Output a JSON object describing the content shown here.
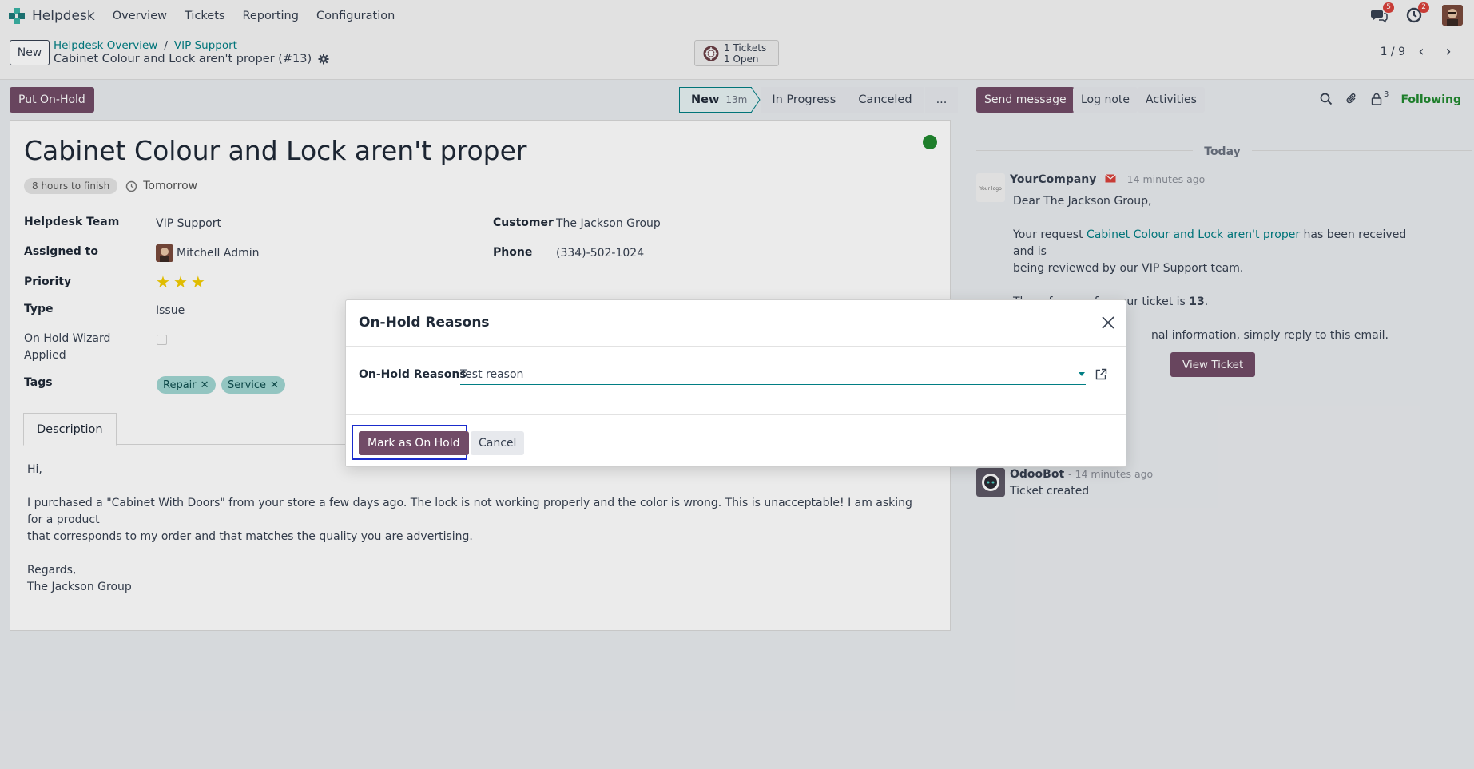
{
  "app": {
    "name": "Helpdesk",
    "menu": [
      "Overview",
      "Tickets",
      "Reporting",
      "Configuration"
    ],
    "messages_count": "5",
    "activities_count": "2"
  },
  "control_panel": {
    "new_label": "New",
    "breadcrumbs": [
      "Helpdesk Overview",
      "VIP Support"
    ],
    "breadcrumb_separator": "/",
    "record_name": "Cabinet Colour and Lock aren't proper (#13)",
    "ticket_stat_line1": "1 Tickets",
    "ticket_stat_line2": "1 Open",
    "pager": "1 / 9"
  },
  "status_bar": {
    "hold_button": "Put On-Hold",
    "stages": [
      {
        "label": "New",
        "duration": "13m",
        "active": true
      },
      {
        "label": "In Progress"
      },
      {
        "label": "Canceled"
      },
      {
        "label": "..."
      }
    ]
  },
  "ticket": {
    "title": "Cabinet Colour and Lock aren't proper",
    "deadline_badge": "8 hours to finish",
    "deadline_date": "Tomorrow",
    "fields": {
      "team_label": "Helpdesk Team",
      "team_value": "VIP Support",
      "assigned_label": "Assigned to",
      "assigned_value": "Mitchell Admin",
      "priority_label": "Priority",
      "priority_stars": 3,
      "type_label": "Type",
      "type_value": "Issue",
      "onhold_label_1": "On Hold Wizard",
      "onhold_label_2": "Applied",
      "tags_label": "Tags",
      "tags": [
        "Repair",
        "Service"
      ],
      "customer_label": "Customer",
      "customer_value": "The Jackson Group",
      "phone_label": "Phone",
      "phone_value": "(334)-502-1024"
    },
    "tab_description": "Description",
    "description": {
      "greeting": "Hi,",
      "body_1": "I purchased a \"Cabinet With Doors\" from your store a few days ago. The lock is not working properly and the color is wrong. This is unacceptable! I am asking for a product",
      "body_2": "that corresponds to my order and that matches the quality you are advertising.",
      "closing_1": "Regards,",
      "closing_2": "The Jackson Group"
    }
  },
  "chatter": {
    "send_message": "Send message",
    "log_note": "Log note",
    "activities": "Activities",
    "followers_count": "3",
    "following": "Following",
    "today_label": "Today",
    "messages": [
      {
        "author": "YourCompany",
        "time": "- 14 minutes ago",
        "avatar_text": "Your logo",
        "line1": "Dear The Jackson Group,",
        "line2_pre": "Your request ",
        "line2_link": "Cabinet Colour and Lock aren't proper",
        "line2_post": " has been received and is",
        "line3": "being reviewed by our VIP Support team.",
        "line4_pre": "The reference for your ticket is ",
        "line4_bold": "13",
        "line4_post": ".",
        "line5_visible": "nal information, simply reply to this email.",
        "button": "View Ticket"
      },
      {
        "author": "OdooBot",
        "time": "- 14 minutes ago",
        "body": "Ticket created"
      }
    ]
  },
  "dialog": {
    "title": "On-Hold Reasons",
    "field_label": "On-Hold Reasons",
    "field_value": "Test reason",
    "confirm_button": "Mark as On Hold",
    "cancel_button": "Cancel"
  },
  "colors": {
    "primary": "#714b67",
    "link": "#017e84",
    "following": "#21892f",
    "focus_ring": "#1a2ccc",
    "tag_bg": "#a0d6d2",
    "star": "#f3cc00",
    "status_dot": "#21892f"
  }
}
